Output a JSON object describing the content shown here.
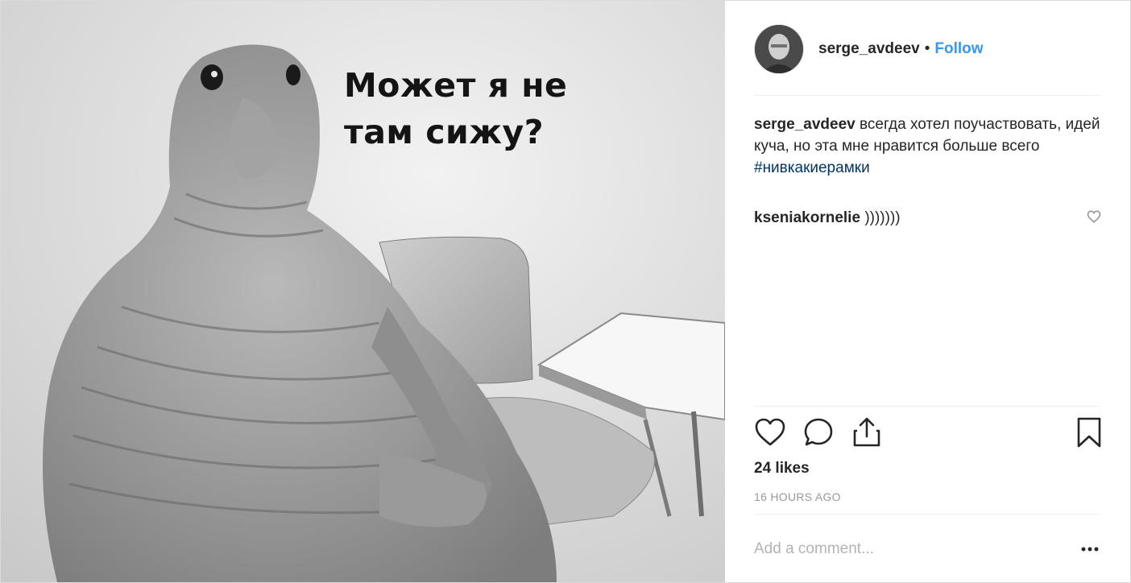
{
  "image": {
    "overlay_text": "Может я не\nтам сижу?"
  },
  "header": {
    "username": "serge_avdeev",
    "separator": "•",
    "follow_label": "Follow"
  },
  "caption": {
    "username": "serge_avdeev",
    "text": "всегда хотел поучаствовать, идей куча, но эта мне нравится больше всего",
    "hashtag": "#нивкакиерамки"
  },
  "comment": {
    "username": "kseniakornelie",
    "text": ")))))))"
  },
  "actions": {
    "icons": [
      "heart-icon",
      "comment-icon",
      "share-icon",
      "bookmark-icon"
    ]
  },
  "likes": "24 likes",
  "timestamp": "16 HOURS AGO",
  "add_comment": {
    "placeholder": "Add a comment..."
  },
  "colors": {
    "link": "#3897f0",
    "hashtag": "#003569",
    "text": "#262626",
    "muted": "#999999"
  }
}
